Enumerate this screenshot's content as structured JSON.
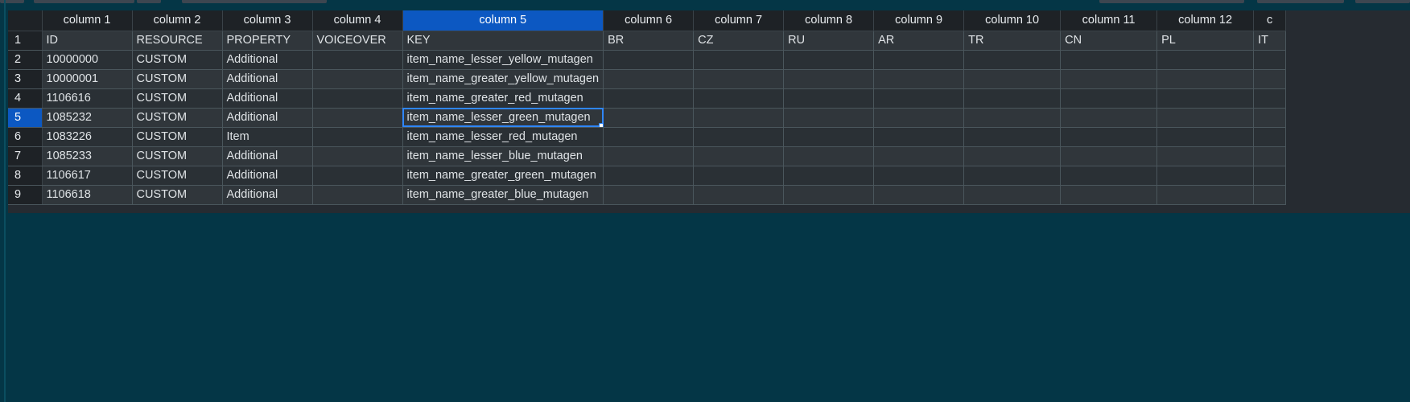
{
  "grid": {
    "column_headers": [
      "column 1",
      "column 2",
      "column 3",
      "column 4",
      "column 5",
      "column 6",
      "column 7",
      "column 8",
      "column 9",
      "column 10",
      "column 11",
      "column 12",
      "c"
    ],
    "selected_column_index": 4,
    "rows": [
      {
        "n": "1",
        "cells": [
          "ID",
          "RESOURCE",
          "PROPERTY",
          "VOICEOVER",
          "KEY",
          "BR",
          "CZ",
          "RU",
          "AR",
          "TR",
          "CN",
          "PL",
          "IT"
        ]
      },
      {
        "n": "2",
        "cells": [
          "10000000",
          "CUSTOM",
          "Additional",
          "",
          "item_name_lesser_yellow_mutagen",
          "",
          "",
          "",
          "",
          "",
          "",
          "",
          ""
        ]
      },
      {
        "n": "3",
        "cells": [
          "10000001",
          "CUSTOM",
          "Additional",
          "",
          "item_name_greater_yellow_mutagen",
          "",
          "",
          "",
          "",
          "",
          "",
          "",
          ""
        ]
      },
      {
        "n": "4",
        "cells": [
          "1106616",
          "CUSTOM",
          "Additional",
          "",
          "item_name_greater_red_mutagen",
          "",
          "",
          "",
          "",
          "",
          "",
          "",
          ""
        ]
      },
      {
        "n": "5",
        "cells": [
          "1085232",
          "CUSTOM",
          "Additional",
          "",
          "item_name_lesser_green_mutagen",
          "",
          "",
          "",
          "",
          "",
          "",
          "",
          ""
        ]
      },
      {
        "n": "6",
        "cells": [
          "1083226",
          "CUSTOM",
          "Item",
          "",
          "item_name_lesser_red_mutagen",
          "",
          "",
          "",
          "",
          "",
          "",
          "",
          ""
        ]
      },
      {
        "n": "7",
        "cells": [
          "1085233",
          "CUSTOM",
          "Additional",
          "",
          "item_name_lesser_blue_mutagen",
          "",
          "",
          "",
          "",
          "",
          "",
          "",
          ""
        ]
      },
      {
        "n": "8",
        "cells": [
          "1106617",
          "CUSTOM",
          "Additional",
          "",
          "item_name_greater_green_mutagen",
          "",
          "",
          "",
          "",
          "",
          "",
          "",
          ""
        ]
      },
      {
        "n": "9",
        "cells": [
          "1106618",
          "CUSTOM",
          "Additional",
          "",
          "item_name_greater_blue_mutagen",
          "",
          "",
          "",
          "",
          "",
          "",
          "",
          ""
        ]
      }
    ],
    "selected_row_index": 4
  },
  "colors": {
    "background": "#043646",
    "selection_accent": "#0c58c2",
    "active_cell_border": "#2f86ff"
  }
}
